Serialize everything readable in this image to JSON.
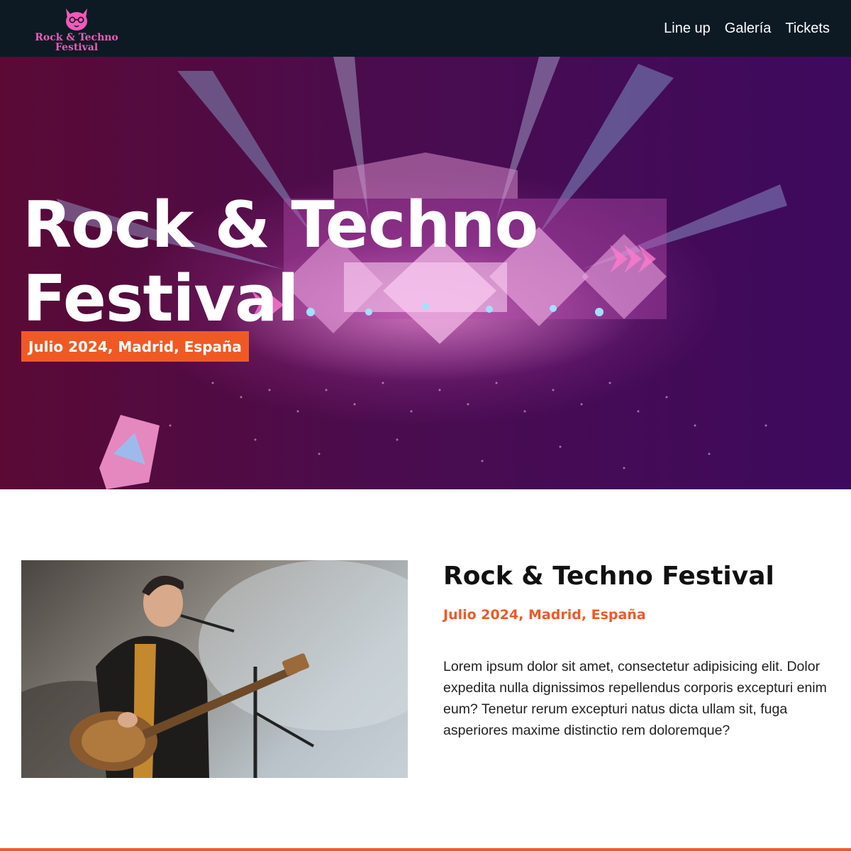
{
  "header": {
    "logo": {
      "line1": "Rock & Techno",
      "line2": "Festival",
      "icon": "cat-glasses-icon"
    },
    "nav": [
      {
        "label": "Line up"
      },
      {
        "label": "Galería"
      },
      {
        "label": "Tickets"
      }
    ]
  },
  "hero": {
    "title": "Rock & Techno Festival",
    "badge": "Julio 2024, Madrid, España"
  },
  "about": {
    "title": "Rock & Techno Festival",
    "date": "Julio 2024, Madrid, España",
    "text": "Lorem ipsum dolor sit amet, consectetur adipisicing elit. Dolor expedita nulla dignissimos repellendus corporis excepturi enim eum? Tenetur rerum excepturi natus dicta ullam sit, fuga asperiores maxime distinctio rem doloremque?"
  },
  "colors": {
    "header_bg": "#0d1a24",
    "accent": "#ef5a24",
    "logo_pink": "#f05ab8"
  }
}
